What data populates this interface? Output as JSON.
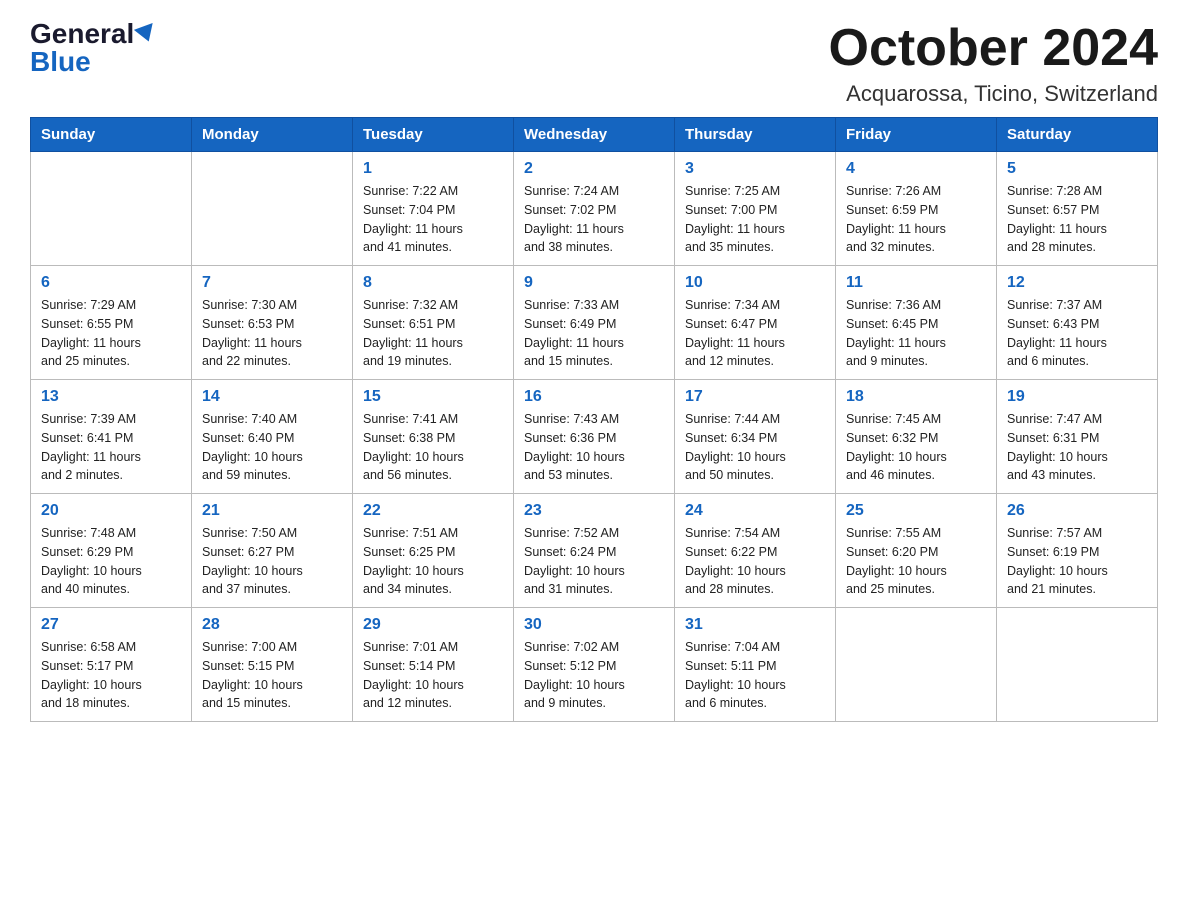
{
  "header": {
    "logo_general": "General",
    "logo_blue": "Blue",
    "month_title": "October 2024",
    "location": "Acquarossa, Ticino, Switzerland"
  },
  "weekdays": [
    "Sunday",
    "Monday",
    "Tuesday",
    "Wednesday",
    "Thursday",
    "Friday",
    "Saturday"
  ],
  "weeks": [
    [
      {
        "day": "",
        "info": ""
      },
      {
        "day": "",
        "info": ""
      },
      {
        "day": "1",
        "info": "Sunrise: 7:22 AM\nSunset: 7:04 PM\nDaylight: 11 hours\nand 41 minutes."
      },
      {
        "day": "2",
        "info": "Sunrise: 7:24 AM\nSunset: 7:02 PM\nDaylight: 11 hours\nand 38 minutes."
      },
      {
        "day": "3",
        "info": "Sunrise: 7:25 AM\nSunset: 7:00 PM\nDaylight: 11 hours\nand 35 minutes."
      },
      {
        "day": "4",
        "info": "Sunrise: 7:26 AM\nSunset: 6:59 PM\nDaylight: 11 hours\nand 32 minutes."
      },
      {
        "day": "5",
        "info": "Sunrise: 7:28 AM\nSunset: 6:57 PM\nDaylight: 11 hours\nand 28 minutes."
      }
    ],
    [
      {
        "day": "6",
        "info": "Sunrise: 7:29 AM\nSunset: 6:55 PM\nDaylight: 11 hours\nand 25 minutes."
      },
      {
        "day": "7",
        "info": "Sunrise: 7:30 AM\nSunset: 6:53 PM\nDaylight: 11 hours\nand 22 minutes."
      },
      {
        "day": "8",
        "info": "Sunrise: 7:32 AM\nSunset: 6:51 PM\nDaylight: 11 hours\nand 19 minutes."
      },
      {
        "day": "9",
        "info": "Sunrise: 7:33 AM\nSunset: 6:49 PM\nDaylight: 11 hours\nand 15 minutes."
      },
      {
        "day": "10",
        "info": "Sunrise: 7:34 AM\nSunset: 6:47 PM\nDaylight: 11 hours\nand 12 minutes."
      },
      {
        "day": "11",
        "info": "Sunrise: 7:36 AM\nSunset: 6:45 PM\nDaylight: 11 hours\nand 9 minutes."
      },
      {
        "day": "12",
        "info": "Sunrise: 7:37 AM\nSunset: 6:43 PM\nDaylight: 11 hours\nand 6 minutes."
      }
    ],
    [
      {
        "day": "13",
        "info": "Sunrise: 7:39 AM\nSunset: 6:41 PM\nDaylight: 11 hours\nand 2 minutes."
      },
      {
        "day": "14",
        "info": "Sunrise: 7:40 AM\nSunset: 6:40 PM\nDaylight: 10 hours\nand 59 minutes."
      },
      {
        "day": "15",
        "info": "Sunrise: 7:41 AM\nSunset: 6:38 PM\nDaylight: 10 hours\nand 56 minutes."
      },
      {
        "day": "16",
        "info": "Sunrise: 7:43 AM\nSunset: 6:36 PM\nDaylight: 10 hours\nand 53 minutes."
      },
      {
        "day": "17",
        "info": "Sunrise: 7:44 AM\nSunset: 6:34 PM\nDaylight: 10 hours\nand 50 minutes."
      },
      {
        "day": "18",
        "info": "Sunrise: 7:45 AM\nSunset: 6:32 PM\nDaylight: 10 hours\nand 46 minutes."
      },
      {
        "day": "19",
        "info": "Sunrise: 7:47 AM\nSunset: 6:31 PM\nDaylight: 10 hours\nand 43 minutes."
      }
    ],
    [
      {
        "day": "20",
        "info": "Sunrise: 7:48 AM\nSunset: 6:29 PM\nDaylight: 10 hours\nand 40 minutes."
      },
      {
        "day": "21",
        "info": "Sunrise: 7:50 AM\nSunset: 6:27 PM\nDaylight: 10 hours\nand 37 minutes."
      },
      {
        "day": "22",
        "info": "Sunrise: 7:51 AM\nSunset: 6:25 PM\nDaylight: 10 hours\nand 34 minutes."
      },
      {
        "day": "23",
        "info": "Sunrise: 7:52 AM\nSunset: 6:24 PM\nDaylight: 10 hours\nand 31 minutes."
      },
      {
        "day": "24",
        "info": "Sunrise: 7:54 AM\nSunset: 6:22 PM\nDaylight: 10 hours\nand 28 minutes."
      },
      {
        "day": "25",
        "info": "Sunrise: 7:55 AM\nSunset: 6:20 PM\nDaylight: 10 hours\nand 25 minutes."
      },
      {
        "day": "26",
        "info": "Sunrise: 7:57 AM\nSunset: 6:19 PM\nDaylight: 10 hours\nand 21 minutes."
      }
    ],
    [
      {
        "day": "27",
        "info": "Sunrise: 6:58 AM\nSunset: 5:17 PM\nDaylight: 10 hours\nand 18 minutes."
      },
      {
        "day": "28",
        "info": "Sunrise: 7:00 AM\nSunset: 5:15 PM\nDaylight: 10 hours\nand 15 minutes."
      },
      {
        "day": "29",
        "info": "Sunrise: 7:01 AM\nSunset: 5:14 PM\nDaylight: 10 hours\nand 12 minutes."
      },
      {
        "day": "30",
        "info": "Sunrise: 7:02 AM\nSunset: 5:12 PM\nDaylight: 10 hours\nand 9 minutes."
      },
      {
        "day": "31",
        "info": "Sunrise: 7:04 AM\nSunset: 5:11 PM\nDaylight: 10 hours\nand 6 minutes."
      },
      {
        "day": "",
        "info": ""
      },
      {
        "day": "",
        "info": ""
      }
    ]
  ]
}
